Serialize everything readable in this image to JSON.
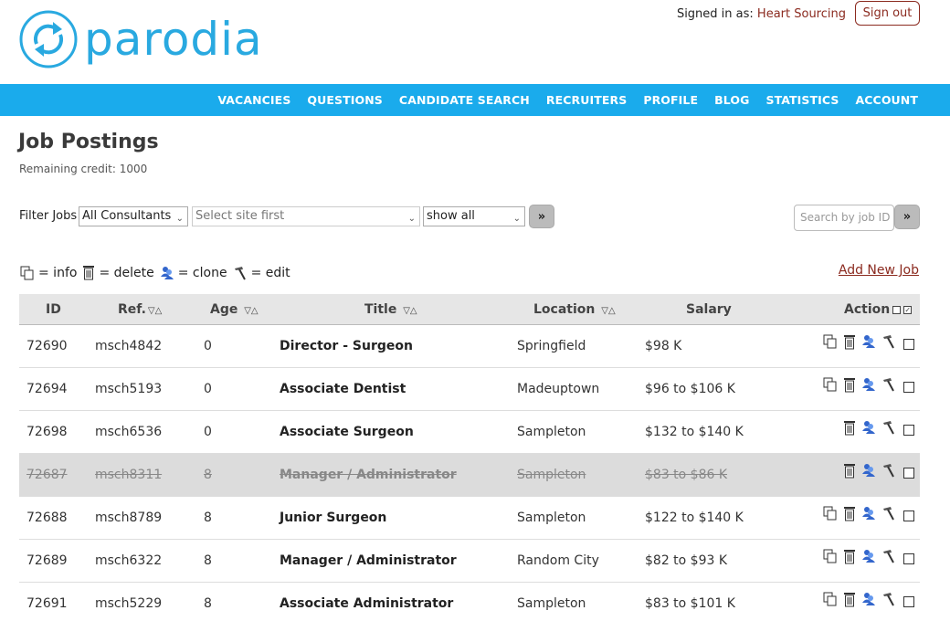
{
  "brand": {
    "name": "parodia",
    "color": "#29a9e0"
  },
  "header": {
    "signed_in_prefix": "Signed in as:",
    "user": "Heart Sourcing",
    "signout_label": "Sign out"
  },
  "nav": {
    "items": [
      "VACANCIES",
      "QUESTIONS",
      "CANDIDATE SEARCH",
      "RECRUITERS",
      "PROFILE",
      "BLOG",
      "STATISTICS",
      "ACCOUNT"
    ],
    "bg_color": "#1aabec"
  },
  "page": {
    "title": "Job Postings",
    "credit": "Remaining credit: 1000"
  },
  "filters": {
    "label": "Filter Jobs",
    "consultants": "All Consultants",
    "site": "Select site first",
    "show": "show all",
    "go_label": "»",
    "search_placeholder": "Search by job ID",
    "search_go_label": "»"
  },
  "legend": {
    "info": "= info",
    "delete": "= delete",
    "clone": "= clone",
    "edit": "= edit",
    "add_new": "Add New Job"
  },
  "table": {
    "headers": {
      "id": "ID",
      "ref": "Ref.",
      "age": "Age",
      "title": "Title",
      "location": "Location",
      "salary": "Salary",
      "action": "Action"
    },
    "sort_glyph": "▽△",
    "rows": [
      {
        "id": "72690",
        "ref": "msch4842",
        "age": "0",
        "title": "Director - Surgeon",
        "location": "Springfield",
        "salary": "$98 K",
        "deleted": false,
        "has_info": true
      },
      {
        "id": "72694",
        "ref": "msch5193",
        "age": "0",
        "title": "Associate Dentist",
        "location": "Madeuptown",
        "salary": "$96 to $106 K",
        "deleted": false,
        "has_info": true
      },
      {
        "id": "72698",
        "ref": "msch6536",
        "age": "0",
        "title": "Associate Surgeon",
        "location": "Sampleton",
        "salary": "$132 to $140 K",
        "deleted": false,
        "has_info": false
      },
      {
        "id": "72687",
        "ref": "msch8311",
        "age": "8",
        "title": "Manager / Administrator",
        "location": "Sampleton",
        "salary": "$83 to $86 K",
        "deleted": true,
        "has_info": false
      },
      {
        "id": "72688",
        "ref": "msch8789",
        "age": "8",
        "title": "Junior Surgeon",
        "location": "Sampleton",
        "salary": "$122 to $140 K",
        "deleted": false,
        "has_info": true
      },
      {
        "id": "72689",
        "ref": "msch6322",
        "age": "8",
        "title": "Manager / Administrator",
        "location": "Random City",
        "salary": "$82 to $93 K",
        "deleted": false,
        "has_info": true
      },
      {
        "id": "72691",
        "ref": "msch5229",
        "age": "8",
        "title": "Associate Administrator",
        "location": "Sampleton",
        "salary": "$83 to $101 K",
        "deleted": false,
        "has_info": true
      }
    ]
  },
  "icons": {
    "info": "info-icon",
    "delete": "trash-icon",
    "clone": "clone-icon",
    "edit": "hammer-icon"
  }
}
